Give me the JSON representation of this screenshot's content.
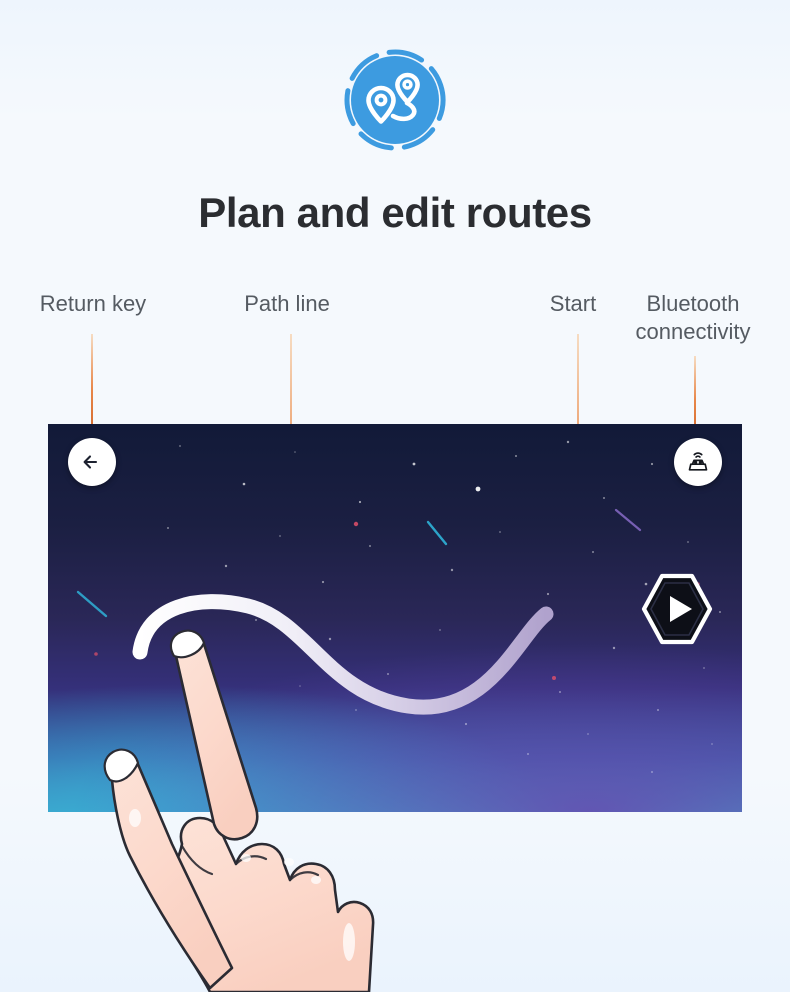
{
  "header": {
    "icon_name": "route-pins-icon",
    "icon_color": "#3d9be0",
    "title": "Plan and edit routes"
  },
  "callouts": [
    {
      "id": "return-key",
      "label": "Return key",
      "leader": "vertical"
    },
    {
      "id": "path-line",
      "label": "Path line",
      "leader": "vertical"
    },
    {
      "id": "start",
      "label": "Start",
      "leader": "elbow"
    },
    {
      "id": "bluetooth",
      "label": "Bluetooth connectivity",
      "leader": "vertical"
    }
  ],
  "screen": {
    "background_description": "starry night sky gradient",
    "colors": {
      "top": "#121a38",
      "mid": "#35307a",
      "bottom": "#3ea6c8",
      "accent_purple": "#6848af",
      "accent_cyan": "#38aad4",
      "leader_orange": "#e8874a",
      "path_start": "#ffffff",
      "path_end": "#b3a6cf"
    },
    "back_button": {
      "name": "back-button",
      "icon": "arrow-left-icon"
    },
    "bluetooth_button": {
      "name": "bluetooth-connectivity-button",
      "icon": "robot-signal-icon"
    },
    "start_button": {
      "name": "start-button",
      "icon": "play-icon",
      "shape": "hexagon"
    },
    "path": {
      "name": "drawn-route-path",
      "shape": "s-curve"
    },
    "hand": {
      "name": "pointing-hand-illustration",
      "gesture": "index-finger-pointing"
    }
  }
}
